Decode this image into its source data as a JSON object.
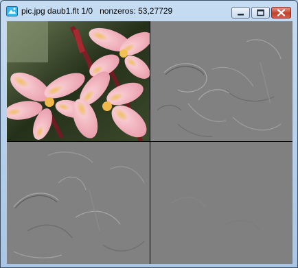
{
  "window": {
    "title": "pic.jpg daub1.flt 1/0   nonzeros: 53,27729",
    "icon": "image-icon",
    "controls": [
      "minimize-icon",
      "maximize-icon",
      "close-icon"
    ]
  },
  "panes": [
    {
      "name": "original-image",
      "kind": "photo",
      "subject": "pink frangipani flowers"
    },
    {
      "name": "horizontal-detail",
      "kind": "edge-map"
    },
    {
      "name": "vertical-detail",
      "kind": "edge-map"
    },
    {
      "name": "diagonal-detail",
      "kind": "flat-gray"
    }
  ],
  "colors": {
    "frame": "#b9d1ea",
    "detail_gray": "#818181",
    "close_red": "#c0412c"
  }
}
